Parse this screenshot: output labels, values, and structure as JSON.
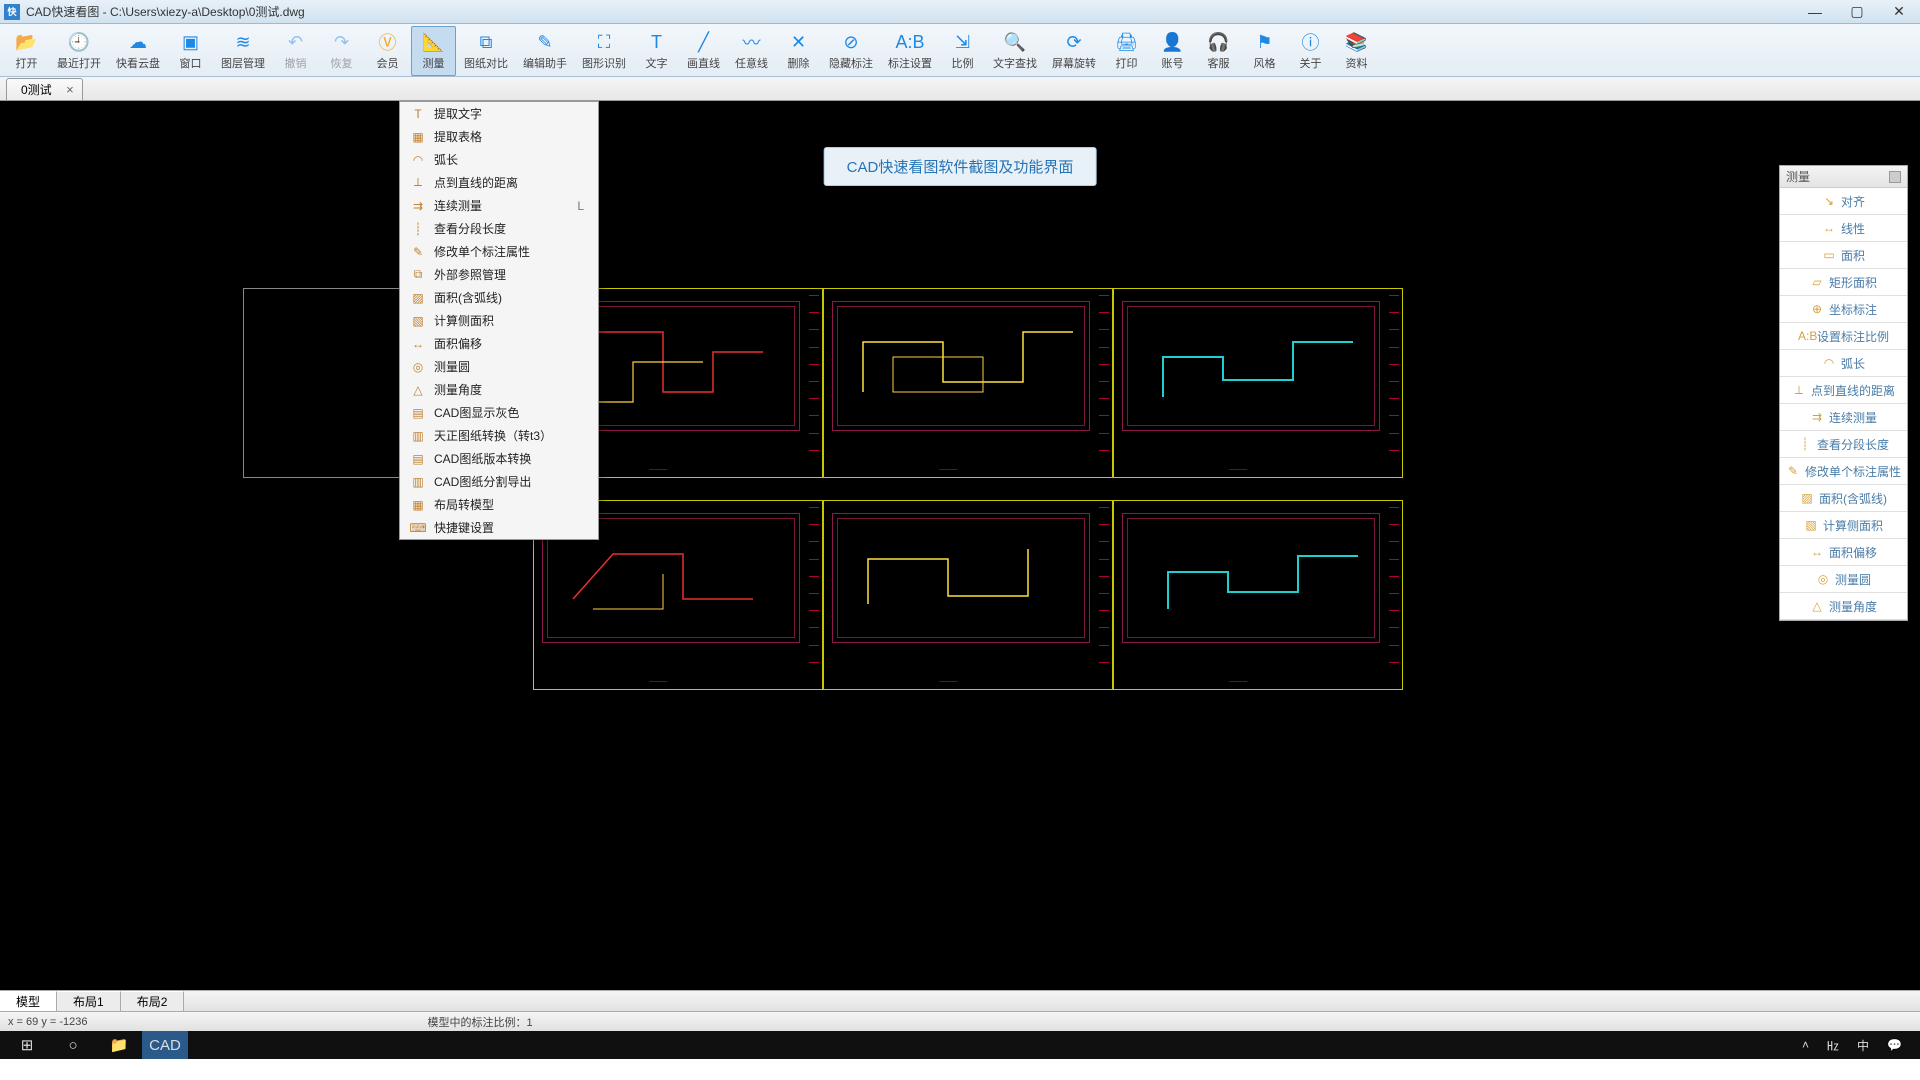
{
  "titlebar": {
    "app_abbr": "快",
    "title": "CAD快速看图 - C:\\Users\\xiezy-a\\Desktop\\0测试.dwg"
  },
  "toolbar": [
    {
      "icon": "📂",
      "label": "打开",
      "name": "open"
    },
    {
      "icon": "🕘",
      "label": "最近打开",
      "name": "recent"
    },
    {
      "icon": "☁",
      "label": "快看云盘",
      "name": "cloud"
    },
    {
      "icon": "▣",
      "label": "窗口",
      "name": "window"
    },
    {
      "icon": "≋",
      "label": "图层管理",
      "name": "layers"
    },
    {
      "icon": "↶",
      "label": "撤销",
      "name": "undo",
      "disabled": true
    },
    {
      "icon": "↷",
      "label": "恢复",
      "name": "redo",
      "disabled": true
    },
    {
      "icon": "Ⓥ",
      "label": "会员",
      "name": "vip",
      "color": "#f5a623"
    },
    {
      "icon": "📐",
      "label": "测量",
      "name": "measure",
      "active": true
    },
    {
      "icon": "⧉",
      "label": "图纸对比",
      "name": "compare"
    },
    {
      "icon": "✎",
      "label": "编辑助手",
      "name": "edit-helper"
    },
    {
      "icon": "⛶",
      "label": "图形识别",
      "name": "recognize"
    },
    {
      "icon": "T",
      "label": "文字",
      "name": "text"
    },
    {
      "icon": "╱",
      "label": "画直线",
      "name": "line"
    },
    {
      "icon": "〰",
      "label": "任意线",
      "name": "polyline"
    },
    {
      "icon": "✕",
      "label": "删除",
      "name": "delete"
    },
    {
      "icon": "⊘",
      "label": "隐藏标注",
      "name": "hide-dim"
    },
    {
      "icon": "A:B",
      "label": "标注设置",
      "name": "dim-settings"
    },
    {
      "icon": "⇲",
      "label": "比例",
      "name": "scale"
    },
    {
      "icon": "🔍",
      "label": "文字查找",
      "name": "find"
    },
    {
      "icon": "⟳",
      "label": "屏幕旋转",
      "name": "rotate"
    },
    {
      "icon": "🖨",
      "label": "打印",
      "name": "print"
    },
    {
      "icon": "👤",
      "label": "账号",
      "name": "account"
    },
    {
      "icon": "🎧",
      "label": "客服",
      "name": "support"
    },
    {
      "icon": "⚑",
      "label": "风格",
      "name": "style"
    },
    {
      "icon": "ⓘ",
      "label": "关于",
      "name": "about"
    },
    {
      "icon": "📚",
      "label": "资料",
      "name": "docs"
    }
  ],
  "file_tab": {
    "label": "0测试"
  },
  "banner": "CAD快速看图软件截图及功能界面",
  "dropdown": [
    {
      "icon": "T",
      "label": "提取文字"
    },
    {
      "icon": "▦",
      "label": "提取表格"
    },
    {
      "icon": "◠",
      "label": "弧长"
    },
    {
      "icon": "⟂",
      "label": "点到直线的距离"
    },
    {
      "icon": "⇉",
      "label": "连续测量",
      "shortcut": "L"
    },
    {
      "icon": "┊",
      "label": "查看分段长度"
    },
    {
      "icon": "✎",
      "label": "修改单个标注属性"
    },
    {
      "icon": "⧉",
      "label": "外部参照管理"
    },
    {
      "icon": "▨",
      "label": "面积(含弧线)"
    },
    {
      "icon": "▧",
      "label": "计算侧面积"
    },
    {
      "icon": "↔",
      "label": "面积偏移"
    },
    {
      "icon": "◎",
      "label": "测量圆"
    },
    {
      "icon": "△",
      "label": "测量角度"
    },
    {
      "icon": "▤",
      "label": "CAD图显示灰色"
    },
    {
      "icon": "▥",
      "label": "天正图纸转换（转t3）"
    },
    {
      "icon": "▤",
      "label": "CAD图纸版本转换"
    },
    {
      "icon": "▥",
      "label": "CAD图纸分割导出"
    },
    {
      "icon": "▦",
      "label": "布局转模型"
    },
    {
      "icon": "⌨",
      "label": "快捷键设置"
    }
  ],
  "side_panel": {
    "title": "测量",
    "items": [
      {
        "icon": "↘",
        "label": "对齐"
      },
      {
        "icon": "↔",
        "label": "线性"
      },
      {
        "icon": "▭",
        "label": "面积"
      },
      {
        "icon": "▱",
        "label": "矩形面积"
      },
      {
        "icon": "⊕",
        "label": "坐标标注"
      },
      {
        "icon": "A:B",
        "label": "设置标注比例"
      },
      {
        "icon": "◠",
        "label": "弧长"
      },
      {
        "icon": "⟂",
        "label": "点到直线的距离"
      },
      {
        "icon": "⇉",
        "label": "连续测量"
      },
      {
        "icon": "┊",
        "label": "查看分段长度"
      },
      {
        "icon": "✎",
        "label": "修改单个标注属性"
      },
      {
        "icon": "▨",
        "label": "面积(含弧线)"
      },
      {
        "icon": "▧",
        "label": "计算侧面积"
      },
      {
        "icon": "↔",
        "label": "面积偏移"
      },
      {
        "icon": "◎",
        "label": "测量圆"
      },
      {
        "icon": "△",
        "label": "测量角度"
      }
    ]
  },
  "layout_tabs": [
    "模型",
    "布局1",
    "布局2"
  ],
  "status": {
    "coords": "x = 69  y = -1236",
    "scale": "模型中的标注比例：1"
  },
  "taskbar": {
    "ime": [
      "㎐",
      "中",
      "⬚"
    ]
  }
}
